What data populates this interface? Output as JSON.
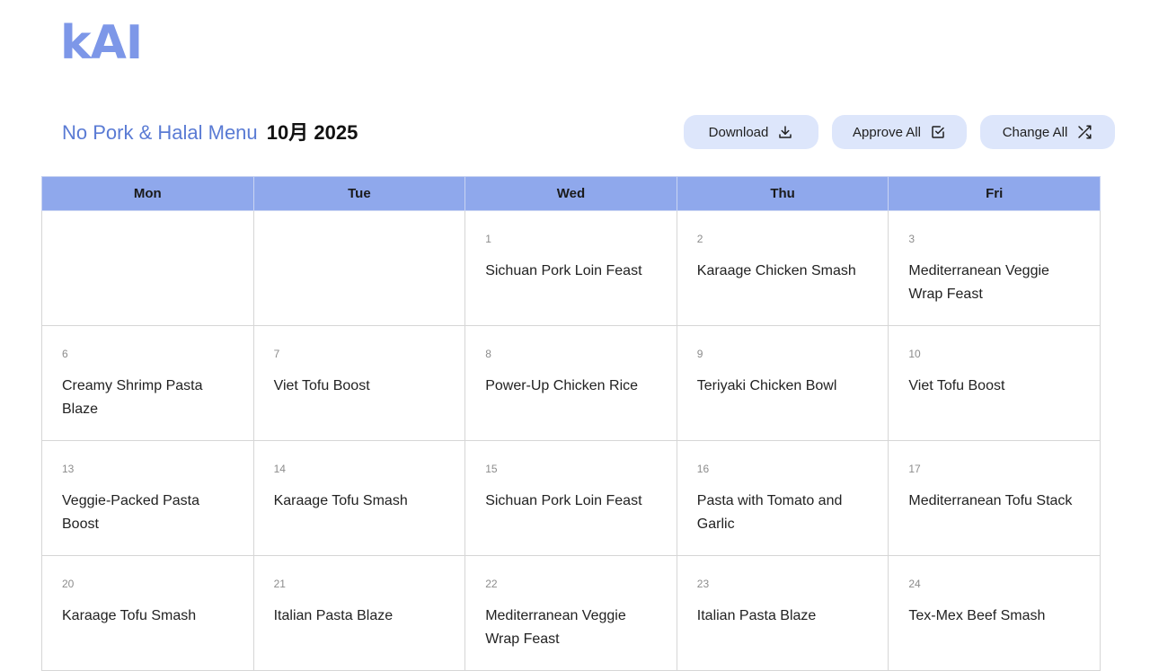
{
  "logo": {
    "text": "kAI"
  },
  "header": {
    "menu_name": "No Pork & Halal Menu",
    "month_label": "10月 2025"
  },
  "toolbar": {
    "download_label": "Download",
    "approve_all_label": "Approve All",
    "change_all_label": "Change All"
  },
  "calendar": {
    "days": [
      "Mon",
      "Tue",
      "Wed",
      "Thu",
      "Fri"
    ],
    "weeks": [
      [
        {
          "day": "",
          "dish": ""
        },
        {
          "day": "",
          "dish": ""
        },
        {
          "day": "1",
          "dish": "Sichuan Pork Loin Feast"
        },
        {
          "day": "2",
          "dish": "Karaage Chicken Smash"
        },
        {
          "day": "3",
          "dish": "Mediterranean Veggie Wrap Feast"
        }
      ],
      [
        {
          "day": "6",
          "dish": "Creamy Shrimp Pasta Blaze"
        },
        {
          "day": "7",
          "dish": "Viet Tofu Boost"
        },
        {
          "day": "8",
          "dish": "Power-Up Chicken Rice"
        },
        {
          "day": "9",
          "dish": "Teriyaki Chicken Bowl"
        },
        {
          "day": "10",
          "dish": "Viet Tofu Boost"
        }
      ],
      [
        {
          "day": "13",
          "dish": "Veggie-Packed Pasta Boost"
        },
        {
          "day": "14",
          "dish": "Karaage Tofu Smash"
        },
        {
          "day": "15",
          "dish": "Sichuan Pork Loin Feast"
        },
        {
          "day": "16",
          "dish": "Pasta with Tomato and Garlic"
        },
        {
          "day": "17",
          "dish": "Mediterranean Tofu Stack"
        }
      ],
      [
        {
          "day": "20",
          "dish": "Karaage Tofu Smash"
        },
        {
          "day": "21",
          "dish": "Italian Pasta Blaze"
        },
        {
          "day": "22",
          "dish": "Mediterranean Veggie Wrap Feast"
        },
        {
          "day": "23",
          "dish": "Italian Pasta Blaze"
        },
        {
          "day": "24",
          "dish": "Tex-Mex Beef Smash"
        }
      ]
    ]
  },
  "icons": {
    "download": "download-icon",
    "approve_all": "checkbox-icon",
    "change_all": "shuffle-icon"
  },
  "colors": {
    "accent": "#7d97e8",
    "title": "#5a7bd4",
    "header_row": "#8fa8ec",
    "button_bg": "#dde6fb"
  }
}
